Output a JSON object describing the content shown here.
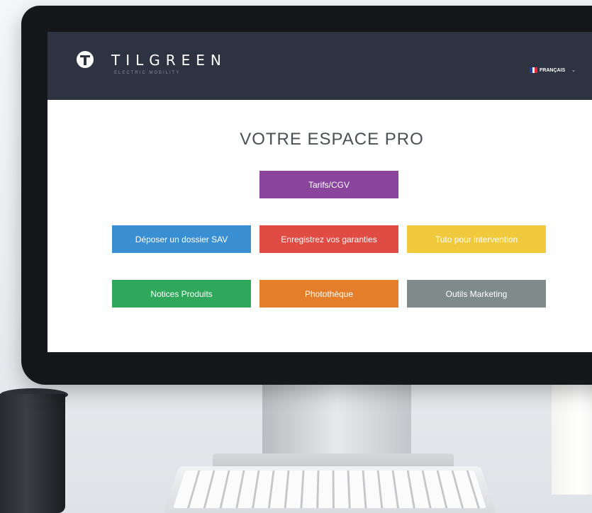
{
  "brand": {
    "name": "TILGREEN",
    "tagline": "ELECTRIC MOBILITY"
  },
  "header": {
    "language": "FRANÇAIS",
    "language_flag": "french-flag-icon"
  },
  "main": {
    "title": "VOTRE ESPACE PRO",
    "buttons": {
      "tarifs": {
        "label": "Tarifs/CGV",
        "color": "#8a449e"
      },
      "sav": {
        "label": "Déposer un dossier SAV",
        "color": "#3a8fd2"
      },
      "garanties": {
        "label": "Enregistrez vos garanties",
        "color": "#e04b43"
      },
      "tuto": {
        "label": "Tuto pour intervention",
        "color": "#f0c93c"
      },
      "notices": {
        "label": "Notices Produits",
        "color": "#30a85c"
      },
      "phototheque": {
        "label": "Photothèque",
        "color": "#e57e2a"
      },
      "marketing": {
        "label": "Outils Marketing",
        "color": "#7f8a8b"
      }
    }
  },
  "colors": {
    "header_bg": "#2d3340",
    "title": "#4a4f58"
  }
}
